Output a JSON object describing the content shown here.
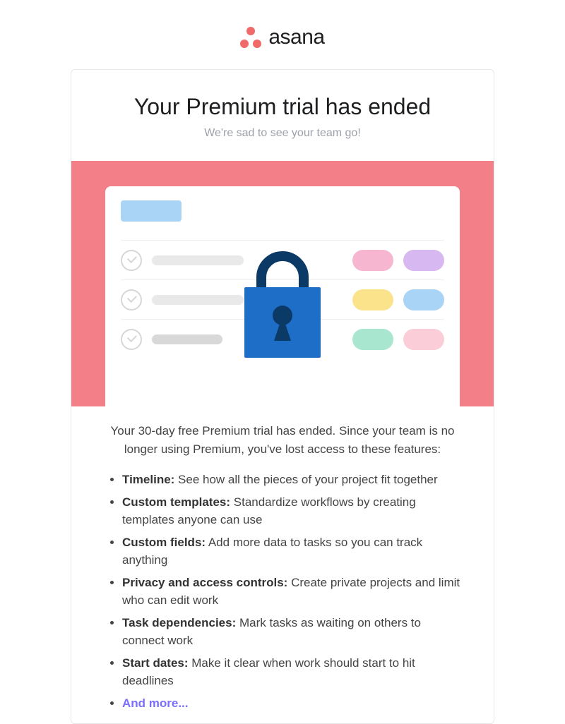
{
  "brand": {
    "name": "asana"
  },
  "header": {
    "title": "Your Premium trial has ended",
    "subtitle": "We're sad to see your team go!"
  },
  "body": {
    "intro": "Your 30-day free Premium trial has ended. Since your team is no longer using Premium, you've lost access to these features:"
  },
  "features": [
    {
      "label": "Timeline:",
      "desc": " See how all the pieces of your project fit together"
    },
    {
      "label": "Custom templates:",
      "desc": " Standardize workflows by creating templates anyone can use"
    },
    {
      "label": "Custom fields:",
      "desc": " Add more data to tasks so you can track anything"
    },
    {
      "label": "Privacy and access controls:",
      "desc": " Create private projects and limit who can edit work"
    },
    {
      "label": "Task dependencies:",
      "desc": " Mark tasks as waiting on others to connect work"
    },
    {
      "label": "Start dates:",
      "desc": " Make it clear when work should start to hit deadlines"
    }
  ],
  "more": "And more..."
}
